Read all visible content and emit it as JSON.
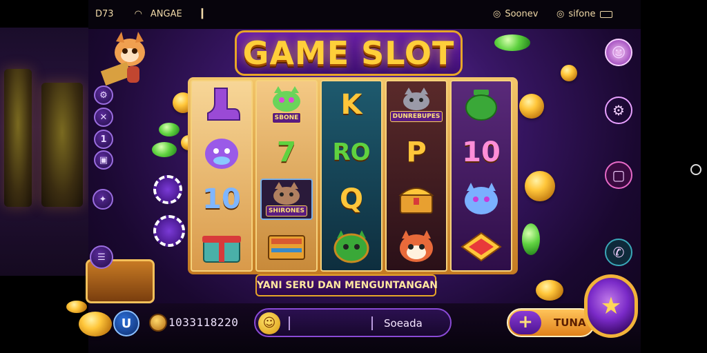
{
  "status_bar": {
    "time": "D73",
    "carrier": "ANGAE",
    "signal_label": "Soonev",
    "network_label": "sifone"
  },
  "game": {
    "title": "GAME SLOT",
    "tagline": "YANI SERU DAN MENGUNTANGAN"
  },
  "reels": [
    {
      "symbols": [
        {
          "icon": "boot-icon"
        },
        {
          "icon": "purple-creature-icon"
        },
        {
          "text": "10",
          "color": "#7fb6ff"
        },
        {
          "icon": "gift-box-icon"
        }
      ]
    },
    {
      "symbols": [
        {
          "icon": "cat-icon",
          "label": "SBONE"
        },
        {
          "text": "7",
          "color": "#5fd240"
        },
        {
          "icon": "cat-badge-icon",
          "label": "SHIRONES"
        },
        {
          "icon": "book-icon"
        }
      ]
    },
    {
      "symbols": [
        {
          "text": "K",
          "color": "#ffc63a"
        },
        {
          "text": "RO",
          "color": "#5fd240"
        },
        {
          "text": "Q",
          "color": "#ffc63a"
        },
        {
          "icon": "green-cat-icon"
        }
      ]
    },
    {
      "symbols": [
        {
          "icon": "cat-badge-icon",
          "label": "DUNREBUPES"
        },
        {
          "text": "P",
          "color": "#ffc63a"
        },
        {
          "icon": "treasure-chest-icon"
        },
        {
          "icon": "red-cat-icon"
        }
      ]
    },
    {
      "symbols": [
        {
          "icon": "green-pot-icon"
        },
        {
          "text": "10",
          "color": "#ff8ed8"
        },
        {
          "icon": "blue-cat-icon"
        },
        {
          "icon": "red-gem-plate-icon"
        }
      ]
    }
  ],
  "bottom": {
    "currency_button": "U",
    "credit": "1033118220",
    "bet_label": "Soeada",
    "spin_label": "TUNA",
    "plus_label": "+"
  },
  "colors": {
    "accent_gold": "#ffcf3a",
    "accent_purple": "#6a1fa8"
  }
}
